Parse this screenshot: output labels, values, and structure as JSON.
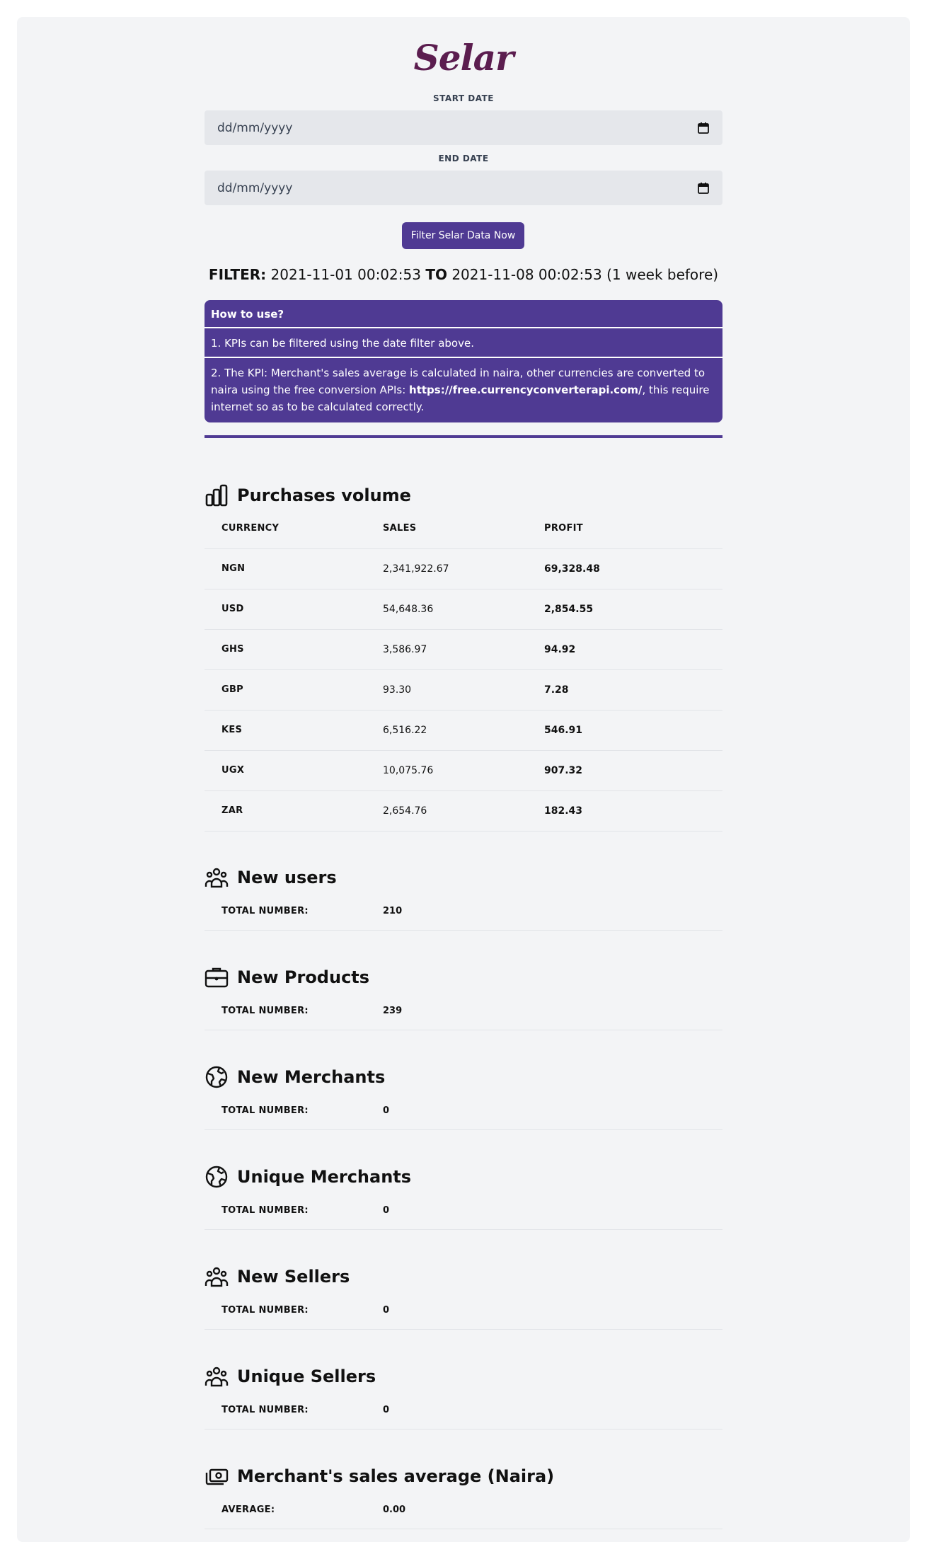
{
  "logo": "Selar",
  "start_date": {
    "label": "START DATE",
    "placeholder": "dd/mm/yyyy"
  },
  "end_date": {
    "label": "END DATE",
    "placeholder": "dd/mm/yyyy"
  },
  "filter_button": "Filter Selar Data Now",
  "filter": {
    "prefix": "FILTER:",
    "from": "2021-11-01 00:02:53",
    "to_word": "TO",
    "to": "2021-11-08 00:02:53 (1 week before)"
  },
  "howto": {
    "title": "How to use?",
    "item1": "1. KPIs can be filtered using the date filter above.",
    "item2_pre": "2. The KPI: Merchant's sales average is calculated in naira, other currencies are converted to naira using the free conversion APIs: ",
    "item2_link": "https://free.currencyconverterapi.com/",
    "item2_post": ", this require internet so as to be calculated correctly."
  },
  "purchases": {
    "title": "Purchases volume",
    "headers": [
      "CURRENCY",
      "SALES",
      "PROFIT"
    ],
    "rows": [
      [
        "NGN",
        "2,341,922.67",
        "69,328.48"
      ],
      [
        "USD",
        "54,648.36",
        "2,854.55"
      ],
      [
        "GHS",
        "3,586.97",
        "94.92"
      ],
      [
        "GBP",
        "93.30",
        "7.28"
      ],
      [
        "KES",
        "6,516.22",
        "546.91"
      ],
      [
        "UGX",
        "10,075.76",
        "907.32"
      ],
      [
        "ZAR",
        "2,654.76",
        "182.43"
      ]
    ]
  },
  "sections": [
    {
      "title": "New users",
      "key": "TOTAL NUMBER:",
      "value": "210",
      "icon": "users-icon"
    },
    {
      "title": "New Products",
      "key": "TOTAL NUMBER:",
      "value": "239",
      "icon": "briefcase-icon"
    },
    {
      "title": "New Merchants",
      "key": "TOTAL NUMBER:",
      "value": "0",
      "icon": "globe-icon"
    },
    {
      "title": "Unique Merchants",
      "key": "TOTAL NUMBER:",
      "value": "0",
      "icon": "globe-icon"
    },
    {
      "title": "New Sellers",
      "key": "TOTAL NUMBER:",
      "value": "0",
      "icon": "users-icon"
    },
    {
      "title": "Unique Sellers",
      "key": "TOTAL NUMBER:",
      "value": "0",
      "icon": "users-icon"
    },
    {
      "title": "Merchant's sales average (Naira)",
      "key": "AVERAGE:",
      "value": "0.00",
      "icon": "cash-icon"
    }
  ],
  "colors": {
    "accent": "#4f3a93",
    "logo": "#5b1d4f",
    "background": "#f3f4f6"
  }
}
